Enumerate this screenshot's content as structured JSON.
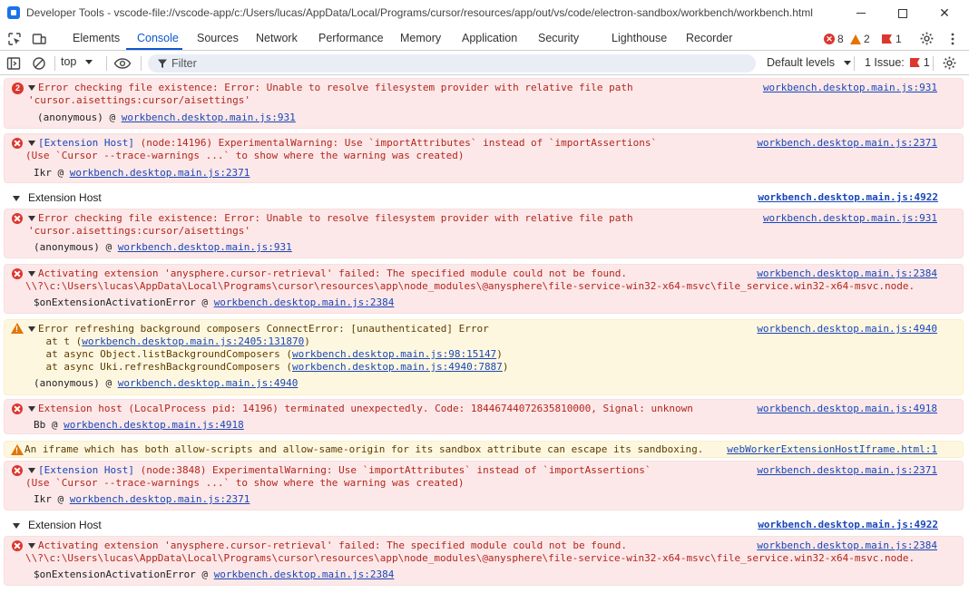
{
  "window": {
    "title": "Developer Tools - vscode-file://vscode-app/c:/Users/lucas/AppData/Local/Programs/cursor/resources/app/out/vs/code/electron-sandbox/workbench/workbench.html",
    "minimize": "–",
    "close": "✕"
  },
  "tabs": [
    "Elements",
    "Console",
    "Sources",
    "Network",
    "Performance",
    "Memory",
    "Application",
    "Security",
    "Lighthouse",
    "Recorder"
  ],
  "counters": {
    "errors": "8",
    "warnings": "2",
    "issues": "1"
  },
  "toolbar": {
    "context": "top",
    "filter_placeholder": "Filter",
    "levels": "Default levels",
    "issues_label": "1 Issue:",
    "issues_count": "1"
  },
  "console": {
    "m1": {
      "count": "2",
      "line1": "Error checking file existence: Error: Unable to resolve filesystem provider with relative file path",
      "line2": "'cursor.aisettings:cursor/aisettings'",
      "source": "workbench.desktop.main.js:931",
      "frame_fn": "(anonymous) @ ",
      "frame_link": "workbench.desktop.main.js:931"
    },
    "m2": {
      "prefix": "[Extension Host]",
      "line1": " (node:14196) ExperimentalWarning: Use `importAttributes` instead of `importAssertions`",
      "line2": "(Use `Cursor --trace-warnings ...` to show where the warning was created)",
      "source": "workbench.desktop.main.js:2371",
      "frame_fn": "Ikr @ ",
      "frame_link": "workbench.desktop.main.js:2371"
    },
    "g1": {
      "label": "Extension Host",
      "source": "workbench.desktop.main.js:4922"
    },
    "m3": {
      "line1": "Error checking file existence: Error: Unable to resolve filesystem provider with relative file path",
      "line2": "'cursor.aisettings:cursor/aisettings'",
      "source": "workbench.desktop.main.js:931",
      "frame_fn": "(anonymous) @ ",
      "frame_link": "workbench.desktop.main.js:931"
    },
    "m4": {
      "line1": "Activating extension 'anysphere.cursor-retrieval' failed: The specified module could not be found.",
      "line2": "\\\\?\\c:\\Users\\lucas\\AppData\\Local\\Programs\\cursor\\resources\\app\\node_modules\\@anysphere\\file-service-win32-x64-msvc\\file_service.win32-x64-msvc.node.",
      "source": "workbench.desktop.main.js:2384",
      "frame_fn": "$onExtensionActivationError @ ",
      "frame_link": "workbench.desktop.main.js:2384"
    },
    "m5": {
      "line1": "Error refreshing background composers ConnectError: [unauthenticated] Error",
      "s1_pre": "    at t (",
      "s1_link": "workbench.desktop.main.js:2405:131870",
      "s2_pre": "    at async Object.listBackgroundComposers (",
      "s2_link": "workbench.desktop.main.js:98:15147",
      "s3_pre": "    at async Uki.refreshBackgroundComposers (",
      "s3_link": "workbench.desktop.main.js:4940:7887",
      "close_paren": ")",
      "source": "workbench.desktop.main.js:4940",
      "frame_fn": "(anonymous) @ ",
      "frame_link": "workbench.desktop.main.js:4940"
    },
    "m6": {
      "line1": "Extension host (LocalProcess pid: 14196) terminated unexpectedly. Code: 18446744072635810000, Signal: unknown",
      "source": "workbench.desktop.main.js:4918",
      "frame_fn": "Bb @ ",
      "frame_link": "workbench.desktop.main.js:4918"
    },
    "m7": {
      "line1": "An iframe which has both allow-scripts and allow-same-origin for its sandbox attribute can escape its sandboxing.",
      "source": "webWorkerExtensionHostIframe.html:1"
    },
    "m8": {
      "prefix": "[Extension Host]",
      "line1": " (node:3848) ExperimentalWarning: Use `importAttributes` instead of `importAssertions`",
      "line2": "(Use `Cursor --trace-warnings ...` to show where the warning was created)",
      "source": "workbench.desktop.main.js:2371",
      "frame_fn": "Ikr @ ",
      "frame_link": "workbench.desktop.main.js:2371"
    },
    "g2": {
      "label": "Extension Host",
      "source": "workbench.desktop.main.js:4922"
    },
    "m9": {
      "line1": "Activating extension 'anysphere.cursor-retrieval' failed: The specified module could not be found.",
      "line2": "\\\\?\\c:\\Users\\lucas\\AppData\\Local\\Programs\\cursor\\resources\\app\\node_modules\\@anysphere\\file-service-win32-x64-msvc\\file_service.win32-x64-msvc.node.",
      "source": "workbench.desktop.main.js:2384",
      "frame_fn": "$onExtensionActivationError @ ",
      "frame_link": "workbench.desktop.main.js:2384"
    }
  },
  "colors": {
    "accent": "#0b57d0",
    "error": "#dc362e",
    "warning": "#e37400",
    "link": "#1a46b8",
    "error_bg": "#fce8e8",
    "warning_bg": "#fef7e0"
  },
  "icons": [
    "devtools-icon",
    "inspect-icon",
    "device-toggle-icon",
    "gear-icon",
    "more-icon",
    "sidebar-icon",
    "clear-icon",
    "eye-icon",
    "filter-icon",
    "error-icon",
    "warning-icon",
    "issue-flag-icon"
  ]
}
